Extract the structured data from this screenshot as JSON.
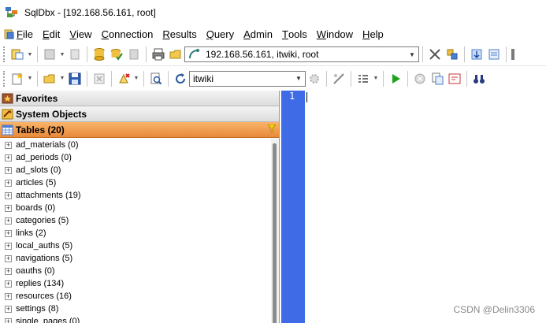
{
  "window": {
    "title": "SqlDbx - [192.168.56.161, root]"
  },
  "menu": {
    "items": [
      {
        "name": "file",
        "pre": "",
        "u": "F",
        "post": "ile"
      },
      {
        "name": "edit",
        "pre": "",
        "u": "E",
        "post": "dit"
      },
      {
        "name": "view",
        "pre": "",
        "u": "V",
        "post": "iew"
      },
      {
        "name": "connection",
        "pre": "",
        "u": "C",
        "post": "onnection"
      },
      {
        "name": "results",
        "pre": "",
        "u": "R",
        "post": "esults"
      },
      {
        "name": "query",
        "pre": "",
        "u": "Q",
        "post": "uery"
      },
      {
        "name": "admin",
        "pre": "",
        "u": "A",
        "post": "dmin"
      },
      {
        "name": "tools",
        "pre": "",
        "u": "T",
        "post": "ools"
      },
      {
        "name": "window",
        "pre": "",
        "u": "W",
        "post": "indow"
      },
      {
        "name": "help",
        "pre": "",
        "u": "H",
        "post": "elp"
      }
    ]
  },
  "toolbar": {
    "connection_value": "192.168.56.161, itwiki, root",
    "database_value": "itwiki"
  },
  "sidebar": {
    "favorites": "Favorites",
    "system_objects": "System Objects",
    "tables_header": "Tables (20)",
    "tables": [
      "ad_materials (0)",
      "ad_periods (0)",
      "ad_slots (0)",
      "articles (5)",
      "attachments (19)",
      "boards (0)",
      "categories (5)",
      "links (2)",
      "local_auths (5)",
      "navigations (5)",
      "oauths (0)",
      "replies (134)",
      "resources (16)",
      "settings (8)",
      "single_pages (0)"
    ]
  },
  "editor": {
    "line_number": "1"
  },
  "watermark": "CSDN @Delin3306",
  "colors": {
    "gutter": "#3f6be6",
    "active_header": "#e8893a"
  }
}
